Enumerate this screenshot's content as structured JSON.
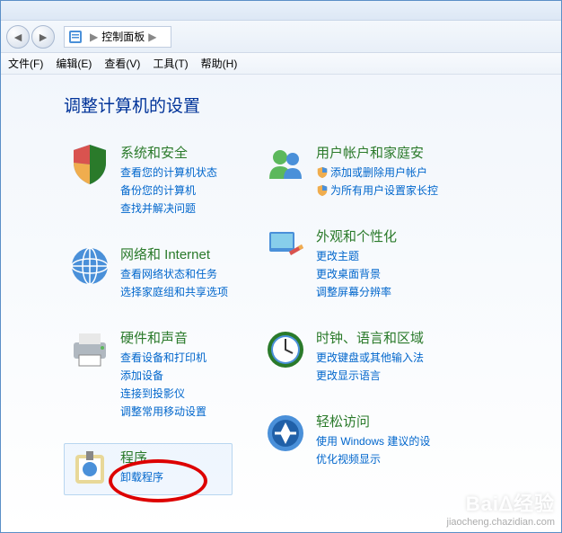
{
  "breadcrumb": {
    "label": "控制面板",
    "separator": "▶",
    "after": "▶"
  },
  "menubar": [
    "文件(F)",
    "编辑(E)",
    "查看(V)",
    "工具(T)",
    "帮助(H)"
  ],
  "heading": "调整计算机的设置",
  "left_categories": [
    {
      "title": "系统和安全",
      "links": [
        "查看您的计算机状态",
        "备份您的计算机",
        "查找并解决问题"
      ]
    },
    {
      "title": "网络和 Internet",
      "links": [
        "查看网络状态和任务",
        "选择家庭组和共享选项"
      ]
    },
    {
      "title": "硬件和声音",
      "links": [
        "查看设备和打印机",
        "添加设备",
        "连接到投影仪",
        "调整常用移动设置"
      ]
    },
    {
      "title": "程序",
      "links": [
        "卸载程序"
      ],
      "selected": true
    }
  ],
  "right_categories": [
    {
      "title": "用户帐户和家庭安",
      "shield_links": [
        "添加或删除用户帐户",
        "为所有用户设置家长控"
      ]
    },
    {
      "title": "外观和个性化",
      "links": [
        "更改主题",
        "更改桌面背景",
        "调整屏幕分辨率"
      ]
    },
    {
      "title": "时钟、语言和区域",
      "links": [
        "更改键盘或其他输入法",
        "更改显示语言"
      ]
    },
    {
      "title": "轻松访问",
      "links": [
        "使用 Windows 建议的设",
        "优化视频显示"
      ]
    }
  ],
  "watermark": {
    "logo": "Baiᐃ经验",
    "sub": "jiaocheng.chazidian.com"
  }
}
